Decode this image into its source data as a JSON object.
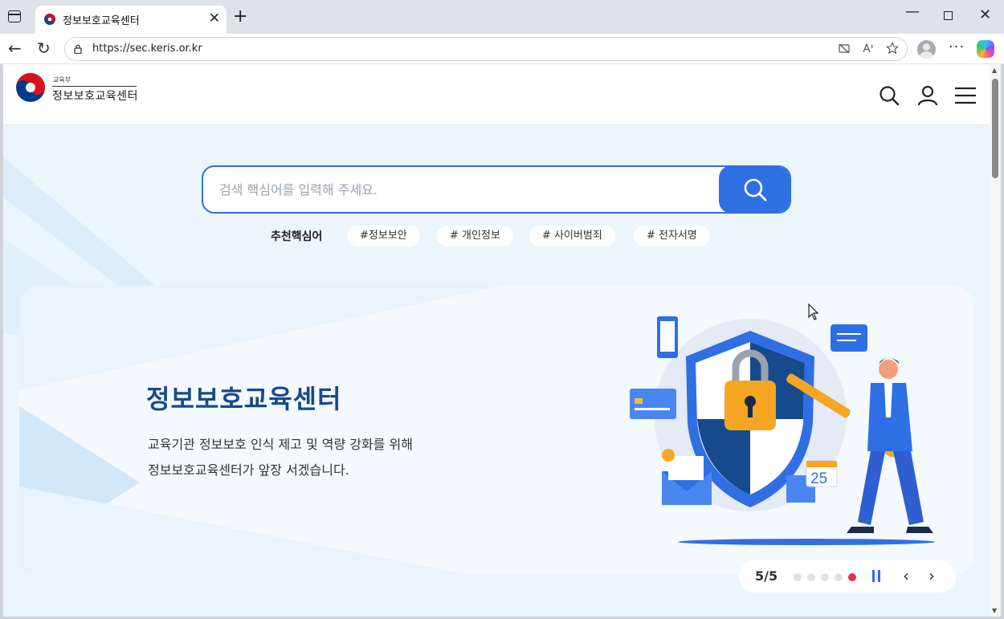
{
  "browser": {
    "tab_title": "정보보호교육센터",
    "tab_close": "✕",
    "new_tab": "+",
    "url": "https://sec.keris.or.kr",
    "window_controls": {
      "minimize": "—",
      "close": "✕"
    },
    "nav": {
      "back": "←",
      "reload": "↻"
    },
    "more": "···"
  },
  "site": {
    "logo_sub": "교육부",
    "logo_text": "정보보호교육센터",
    "header_icons": [
      "search-icon",
      "user-icon",
      "menu-icon"
    ]
  },
  "search": {
    "placeholder": "검색 핵심어를 입력해 주세요.",
    "recommend_label": "추천핵심어",
    "chips": [
      "#정보보안",
      "# 개인정보",
      "# 사이버범죄",
      "# 전자서명"
    ]
  },
  "banner": {
    "title": "정보보호교육센터",
    "desc_line1": "교육기관 정보보호 인식 제고 및 역량 강화를 위해",
    "desc_line2": "정보보호교육센터가 앞장 서겠습니다.",
    "calendar_day": "25"
  },
  "slider": {
    "count": "5/5",
    "total": 5,
    "active_index": 4,
    "prev": "‹",
    "next": "›"
  },
  "colors": {
    "accent": "#2f6fe4",
    "title": "#174a8c",
    "active_dot": "#e5304a",
    "hero_bg": "#eaf5fc"
  }
}
